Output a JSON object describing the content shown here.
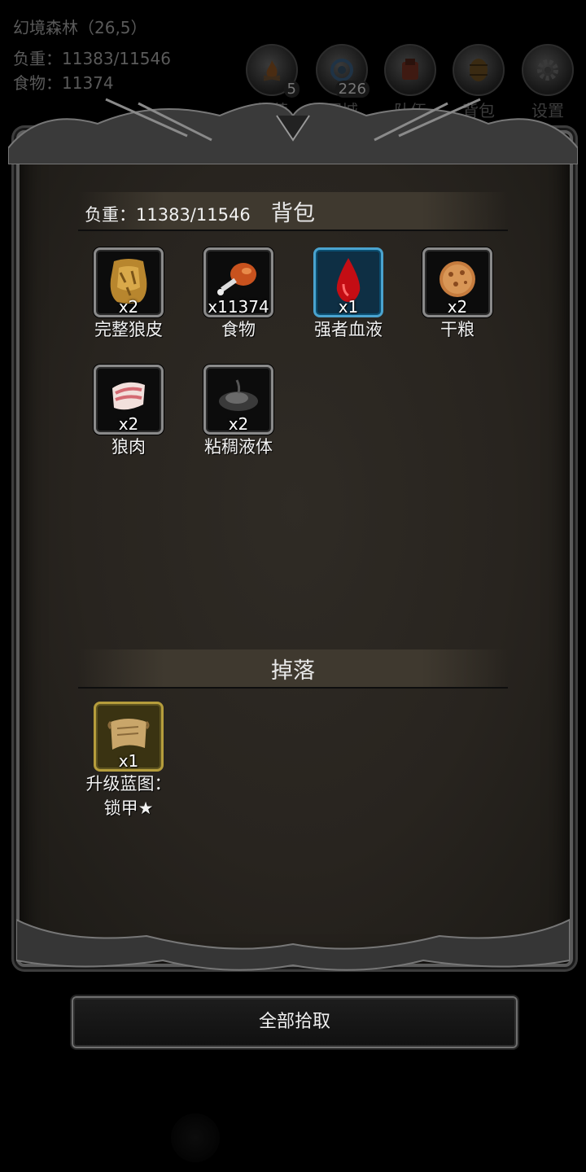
{
  "hud": {
    "location": "幻境森林（26,5）",
    "load": "负重：11383/11546",
    "food": "食物：11374"
  },
  "top_buttons": [
    {
      "label": "扎营",
      "badge": "5",
      "icon": "campfire-icon"
    },
    {
      "label": "回城",
      "badge": "226",
      "icon": "portal-icon"
    },
    {
      "label": "队伍",
      "badge": "",
      "icon": "team-icon"
    },
    {
      "label": "背包",
      "badge": "",
      "icon": "barrel-icon"
    },
    {
      "label": "设置",
      "badge": "",
      "icon": "gear-icon"
    }
  ],
  "bag": {
    "title": "背包",
    "load": "负重：11383/11546",
    "items": [
      {
        "name": "完整狼皮",
        "count": "x2",
        "icon": "wolf-pelt-icon",
        "frame": "normal"
      },
      {
        "name": "食物",
        "count": "x11374",
        "icon": "meat-drumstick-icon",
        "frame": "normal"
      },
      {
        "name": "强者血液",
        "count": "x1",
        "icon": "blood-drop-icon",
        "frame": "blue"
      },
      {
        "name": "干粮",
        "count": "x2",
        "icon": "biscuit-icon",
        "frame": "normal"
      },
      {
        "name": "狼肉",
        "count": "x2",
        "icon": "raw-meat-icon",
        "frame": "normal"
      },
      {
        "name": "粘稠液体",
        "count": "x2",
        "icon": "sticky-liquid-icon",
        "frame": "normal"
      }
    ]
  },
  "drops": {
    "title": "掉落",
    "items": [
      {
        "name_line1": "升级蓝图：",
        "name_line2": "锁甲★",
        "count": "x1",
        "icon": "scroll-icon",
        "frame": "gold"
      }
    ]
  },
  "pickup_all_label": "全部拾取"
}
